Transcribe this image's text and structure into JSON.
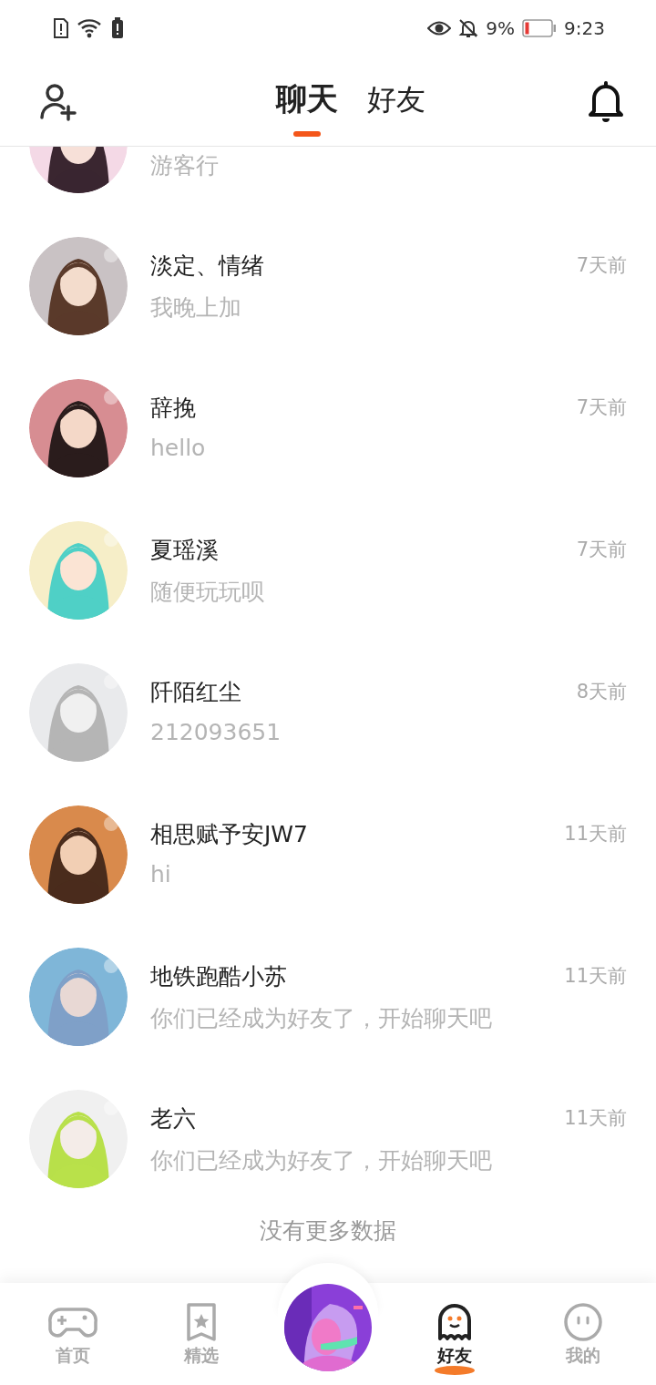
{
  "status_bar": {
    "battery": "9%",
    "time": "9:23"
  },
  "header": {
    "tabs": [
      {
        "label": "聊天",
        "selected": true
      },
      {
        "label": "好友",
        "selected": false
      }
    ]
  },
  "chats": [
    {
      "preview": "游客行"
    },
    {
      "name": "淡定、情绪",
      "preview": "我晚上加",
      "time": "7天前"
    },
    {
      "name": "辞挽",
      "preview": "hello",
      "time": "7天前"
    },
    {
      "name": "夏瑶溪",
      "preview": "随便玩玩呗",
      "time": "7天前"
    },
    {
      "name": "阡陌红尘",
      "preview": "212093651",
      "time": "8天前"
    },
    {
      "name": "相思赋予安JW7",
      "preview": "hi",
      "time": "11天前"
    },
    {
      "name": "地铁跑酷小苏",
      "preview": "你们已经成为好友了，开始聊天吧",
      "time": "11天前"
    },
    {
      "name": "老六",
      "preview": "你们已经成为好友了，开始聊天吧",
      "time": "11天前"
    }
  ],
  "footer": "没有更多数据",
  "nav": [
    {
      "label": "首页",
      "kind": "gamepad",
      "selected": false
    },
    {
      "label": "精选",
      "kind": "bookmark",
      "selected": false
    },
    {
      "kind": "center"
    },
    {
      "label": "好友",
      "kind": "ghost",
      "selected": true
    },
    {
      "label": "我的",
      "kind": "face",
      "selected": false
    }
  ]
}
